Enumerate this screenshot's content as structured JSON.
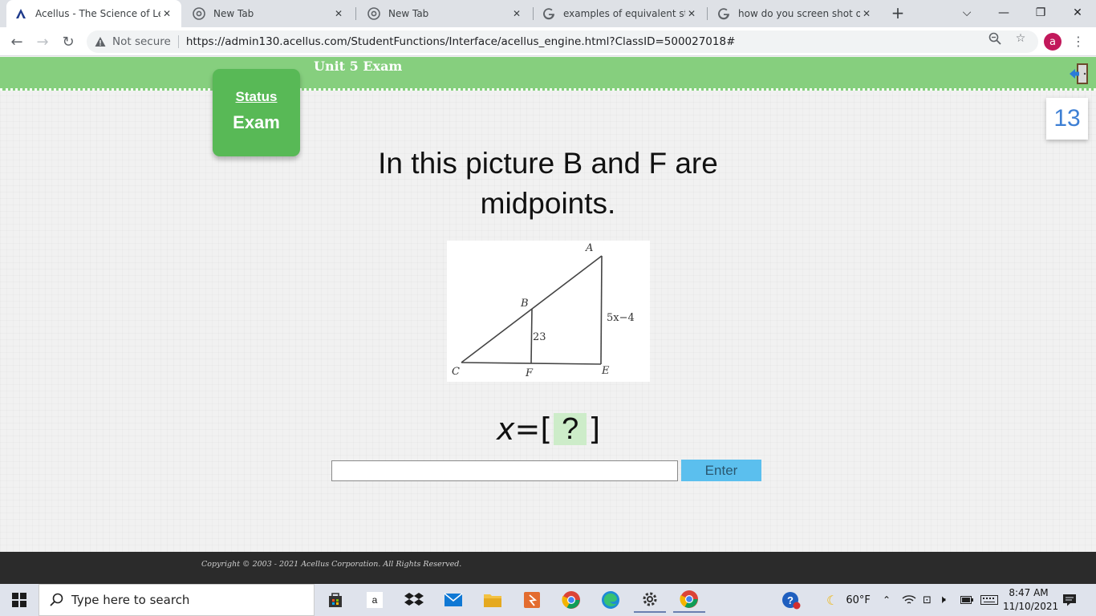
{
  "browser": {
    "tabs": [
      {
        "title": "Acellus - The Science of Lear",
        "icon": "acellus-logo-icon",
        "active": true
      },
      {
        "title": "New Tab",
        "icon": "chrome-icon",
        "active": false
      },
      {
        "title": "New Tab",
        "icon": "chrome-icon",
        "active": false
      },
      {
        "title": "examples of equivalent state",
        "icon": "google-icon",
        "active": false
      },
      {
        "title": "how do you screen shot on a",
        "icon": "google-icon",
        "active": false
      }
    ],
    "security_label": "Not secure",
    "url": "https://admin130.acellus.com/StudentFunctions/Interface/acellus_engine.html?ClassID=500027018#",
    "profile_initial": "a"
  },
  "exam": {
    "unit_title": "Unit 5 Exam",
    "status_link": "Status",
    "status_mode": "Exam",
    "counter": "13",
    "question": "In this picture B and F are midpoints.",
    "figure": {
      "points": [
        "A",
        "B",
        "C",
        "E",
        "F"
      ],
      "label_segment_bf": "23",
      "label_segment_ae": "5x−4"
    },
    "answer": {
      "variable": "x",
      "equals": "=",
      "open": "[",
      "slot": "?",
      "close": "]"
    },
    "input_value": "",
    "enter_label": "Enter"
  },
  "footer": {
    "copyright": "Copyright © 2003 - 2021 Acellus Corporation.  All Rights Reserved."
  },
  "taskbar": {
    "search_placeholder": "Type here to search",
    "weather": "60°F",
    "time": "8:47 AM",
    "date": "11/10/2021"
  }
}
